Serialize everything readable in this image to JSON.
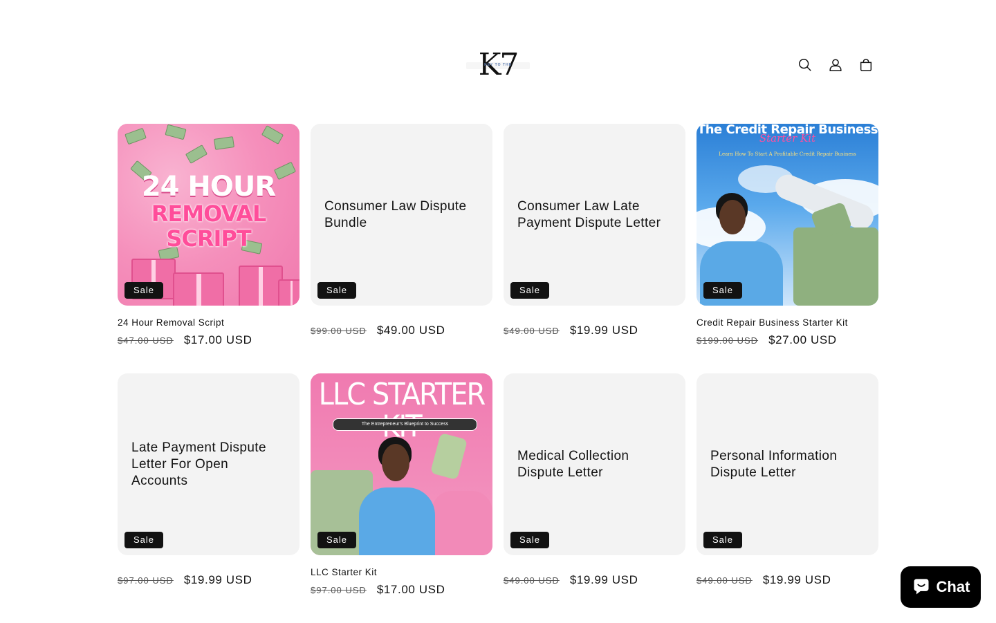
{
  "header": {
    "logo_text": "K7",
    "logo_tagline": "KEY TO THE",
    "icons": {
      "search": "search-icon",
      "account": "account-icon",
      "cart": "cart-icon"
    }
  },
  "products": [
    {
      "title": "24 Hour Removal Script",
      "has_image": true,
      "image_kind": "removal-script",
      "badge": "Sale",
      "compare_price": "$47.00 USD",
      "price": "$17.00 USD",
      "art_title": "24 HOUR",
      "art_sub": "REMOVAL SCRIPT"
    },
    {
      "title": "Consumer Law Dispute Bundle",
      "has_image": false,
      "badge": "Sale",
      "compare_price": "$99.00 USD",
      "price": "$49.00 USD"
    },
    {
      "title": "Consumer Law Late Payment Dispute Letter",
      "has_image": false,
      "badge": "Sale",
      "compare_price": "$49.00 USD",
      "price": "$19.99 USD"
    },
    {
      "title": "Credit Repair Business Starter Kit",
      "has_image": true,
      "image_kind": "credit-repair",
      "badge": "Sale",
      "compare_price": "$199.00 USD",
      "price": "$27.00 USD",
      "art_title": "The Credit Repair Business",
      "art_sub": "Starter Kit",
      "art_tag": "Learn How To Start A Profitable Credit Repair Business"
    },
    {
      "title": "Late Payment Dispute Letter For Open Accounts",
      "has_image": false,
      "badge": "Sale",
      "compare_price": "$97.00 USD",
      "price": "$19.99 USD"
    },
    {
      "title": "LLC Starter Kit",
      "has_image": true,
      "image_kind": "llc",
      "badge": "Sale",
      "compare_price": "$97.00 USD",
      "price": "$17.00 USD",
      "art_title": "LLC STARTER KIT",
      "art_pill": "The Entrepreneur's Blueprint to Success"
    },
    {
      "title": "Medical Collection Dispute Letter",
      "has_image": false,
      "badge": "Sale",
      "compare_price": "$49.00 USD",
      "price": "$19.99 USD"
    },
    {
      "title": "Personal Information Dispute Letter",
      "has_image": false,
      "badge": "Sale",
      "compare_price": "$49.00 USD",
      "price": "$19.99 USD"
    }
  ],
  "chat": {
    "label": "Chat",
    "icon": "chat-bubble-icon"
  },
  "colors": {
    "text": "#121212",
    "badge_bg": "#121212",
    "placeholder_bg": "#f3f3f3",
    "chat_bg": "#000000"
  }
}
